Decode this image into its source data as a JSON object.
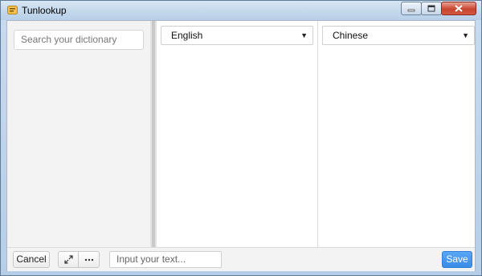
{
  "window": {
    "title": "Tunlookup",
    "accent": "#3a8ce6"
  },
  "sidebar": {
    "search_placeholder": "Search your dictionary"
  },
  "panes": {
    "source_language": "English",
    "target_language": "Chinese"
  },
  "footer": {
    "cancel_label": "Cancel",
    "input_placeholder": "Input your text...",
    "save_label": "Save",
    "icons": [
      "expand-icon",
      "more-icon"
    ]
  }
}
